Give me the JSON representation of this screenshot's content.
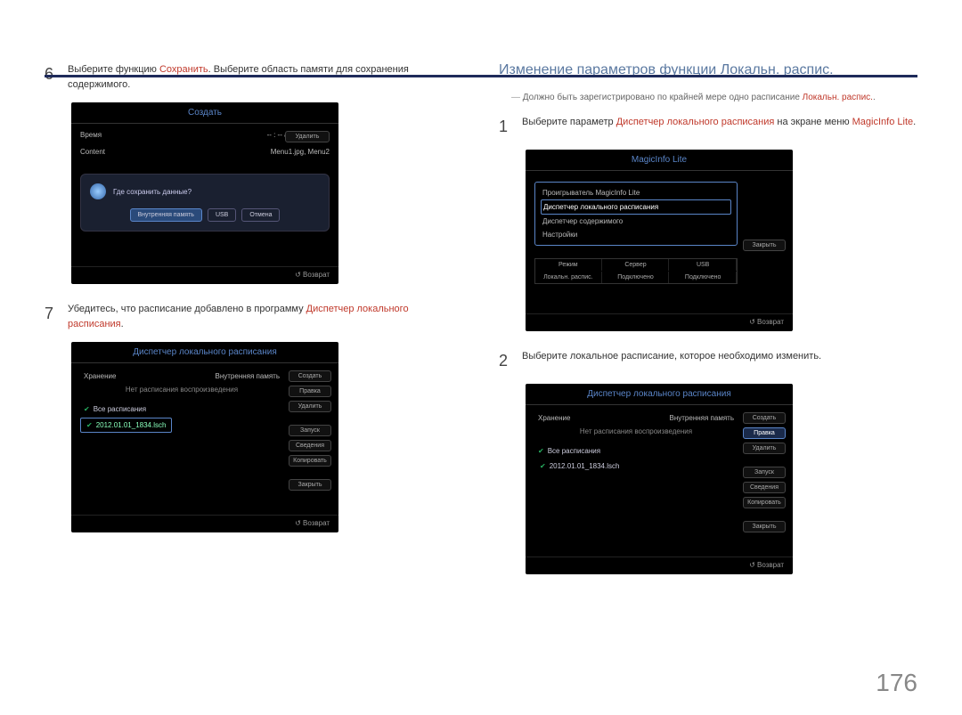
{
  "page_number": "176",
  "colors": {
    "accent": "#c0392b",
    "link": "#5a85c8"
  },
  "left": {
    "step6": {
      "num": "6",
      "text_pre": "Выберите функцию ",
      "save_hl": "Сохранить",
      "text_post": ". Выберите область памяти для сохранения содержимого."
    },
    "fig6": {
      "title": "Создать",
      "time_label": "Время",
      "time_val": "-- : -- am ~ -- : -- pm",
      "content_label": "Content",
      "content_val": "Menu1.jpg, Menu2",
      "delete_btn": "Удалить",
      "dialog_q": "Где сохранить данные?",
      "btn_internal": "Внутренняя память",
      "btn_usb": "USB",
      "btn_cancel": "Отмена",
      "return": "Возврат"
    },
    "step7": {
      "num": "7",
      "text_pre": "Убедитесь, что расписание добавлено в программу ",
      "dispatcher_hl": "Диспетчер локального расписания",
      "text_post": "."
    },
    "fig7": {
      "title": "Диспетчер локального расписания",
      "storage_label": "Хранение",
      "storage_val": "Внутренняя память",
      "no_sched": "Нет расписания воспроизведения",
      "all_sched": "Все расписания",
      "file": "2012.01.01_1834.lsch",
      "btns": [
        "Создать",
        "Правка",
        "Удалить",
        "Запуск",
        "Сведения",
        "Копировать",
        "Закрыть"
      ],
      "return": "Возврат"
    }
  },
  "right": {
    "heading": "Изменение параметров функции Локальн. распис.",
    "note_pre": "Должно быть зарегистрировано по крайней мере одно расписание ",
    "note_hl": "Локальн. распис.",
    "note_post": ".",
    "step1": {
      "num": "1",
      "text_pre": "Выберите параметр ",
      "disp_hl": "Диспетчер локального расписания",
      "text_mid": " на экране меню ",
      "ml_hl": "MagicInfo Lite",
      "text_post": "."
    },
    "fig1": {
      "title": "MagicInfo Lite",
      "items": [
        "Проигрыватель MagicInfo Lite",
        "Диспетчер локального расписания",
        "Диспетчер содержимого",
        "Настройки"
      ],
      "highlighted_index": 1,
      "close_btn": "Закрыть",
      "grid_h": [
        "Режим",
        "Сервер",
        "USB"
      ],
      "grid_v": [
        "Локальн. распис.",
        "Подключено",
        "Подключено"
      ],
      "return": "Возврат"
    },
    "step2": {
      "num": "2",
      "text": "Выберите локальное расписание, которое необходимо изменить."
    },
    "fig2": {
      "title": "Диспетчер локального расписания",
      "storage_label": "Хранение",
      "storage_val": "Внутренняя память",
      "no_sched": "Нет расписания воспроизведения",
      "all_sched": "Все расписания",
      "file": "2012.01.01_1834.lsch",
      "btns": [
        "Создать",
        "Правка",
        "Удалить",
        "Запуск",
        "Сведения",
        "Копировать",
        "Закрыть"
      ],
      "hl_btn_index": 1,
      "return": "Возврат"
    }
  }
}
